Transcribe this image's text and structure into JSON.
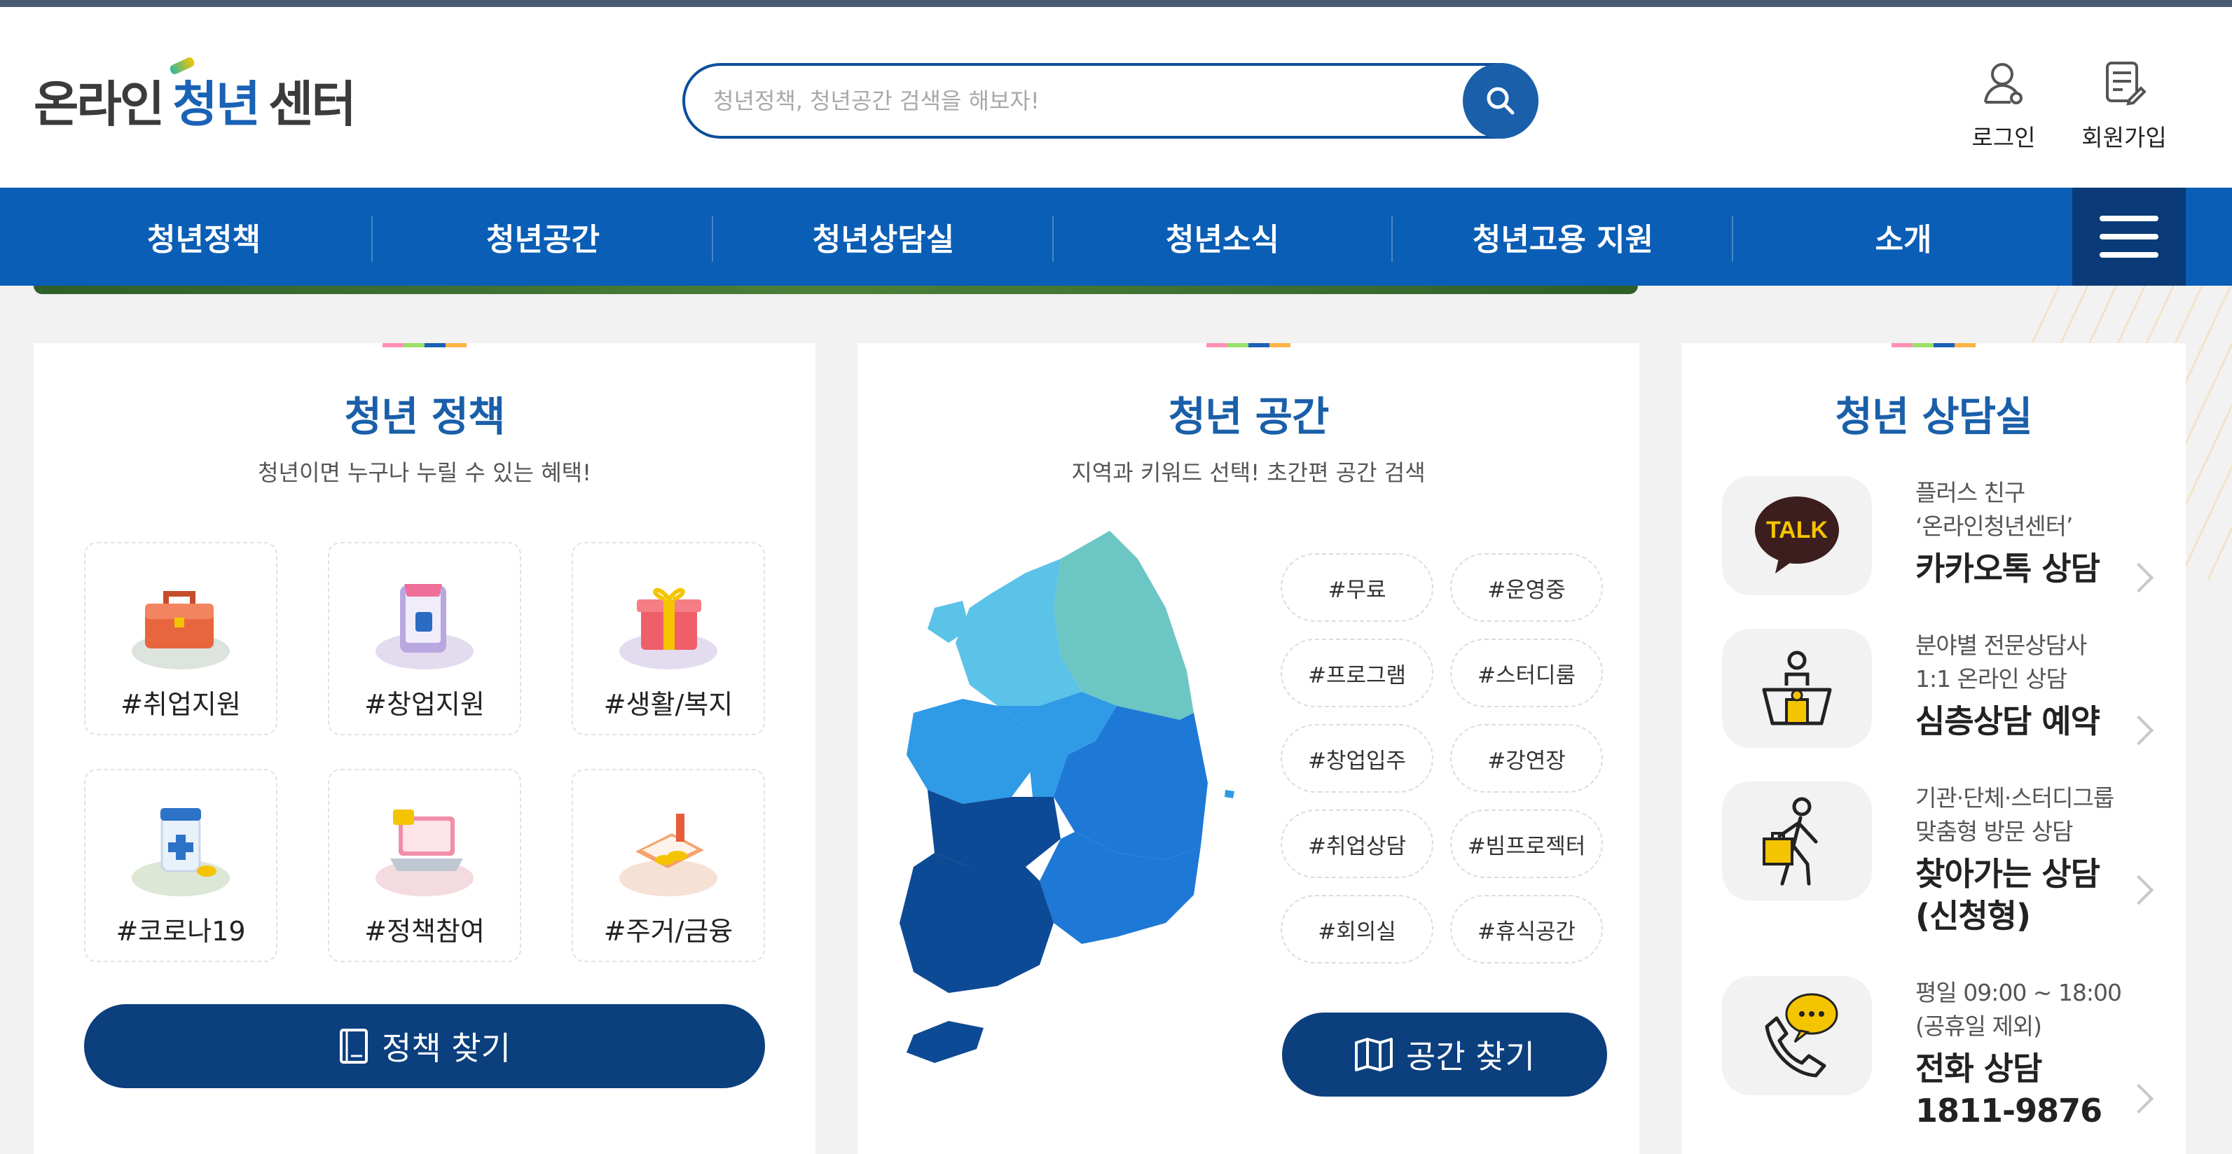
{
  "header": {
    "logo": {
      "part1": "온라인",
      "part2": "청년",
      "part3": "센터"
    },
    "search_placeholder": "청년정책, 청년공간 검색을 해보자!",
    "login_label": "로그인",
    "signup_label": "회원가입"
  },
  "nav": {
    "items": [
      "청년정책",
      "청년공간",
      "청년상담실",
      "청년소식",
      "청년고용 지원",
      "소개"
    ]
  },
  "policy": {
    "title": "청년 정책",
    "subtitle": "청년이면 누구나 누릴 수 있는 혜택!",
    "tiles": [
      "#취업지원",
      "#창업지원",
      "#생활/복지",
      "#코로나19",
      "#정책참여",
      "#주거/금융"
    ],
    "button_label": "정책 찾기"
  },
  "space": {
    "title": "청년 공간",
    "subtitle": "지역과 키워드 선택! 초간편 공간 검색",
    "tags": [
      "#무료",
      "#운영중",
      "#프로그램",
      "#스터디룸",
      "#창업입주",
      "#강연장",
      "#취업상담",
      "#빔프로젝터",
      "#회의실",
      "#휴식공간"
    ],
    "button_label": "공간 찾기"
  },
  "consult": {
    "title": "청년 상담실",
    "items": [
      {
        "small1": "플러스 친구",
        "small2": "‘온라인청년센터’",
        "big1": "카카오톡 상담",
        "big2": ""
      },
      {
        "small1": "분야별 전문상담사",
        "small2": "1:1 온라인 상담",
        "big1": "심층상담 예약",
        "big2": ""
      },
      {
        "small1": "기관·단체·스터디그룹",
        "small2": "맞춤형 방문 상담",
        "big1": "찾아가는 상담",
        "big2": "(신청형)"
      },
      {
        "small1": "평일 09:00 ~ 18:00",
        "small2": "(공휴일 제외)",
        "big1": "전화 상담",
        "big2": "1811-9876"
      }
    ],
    "kakao_icon_text": "TALK"
  },
  "colors": {
    "brand_blue": "#0a5eb5",
    "dark_navy": "#0b3f7e",
    "title_blue": "#1a5fa9"
  },
  "icons": [
    "search-icon",
    "login-user-icon",
    "signup-doc-icon",
    "hamburger-menu-icon",
    "book-icon",
    "map-icon",
    "kakao-talk-icon",
    "counselor-icon",
    "visiting-person-icon",
    "phone-chat-icon"
  ]
}
